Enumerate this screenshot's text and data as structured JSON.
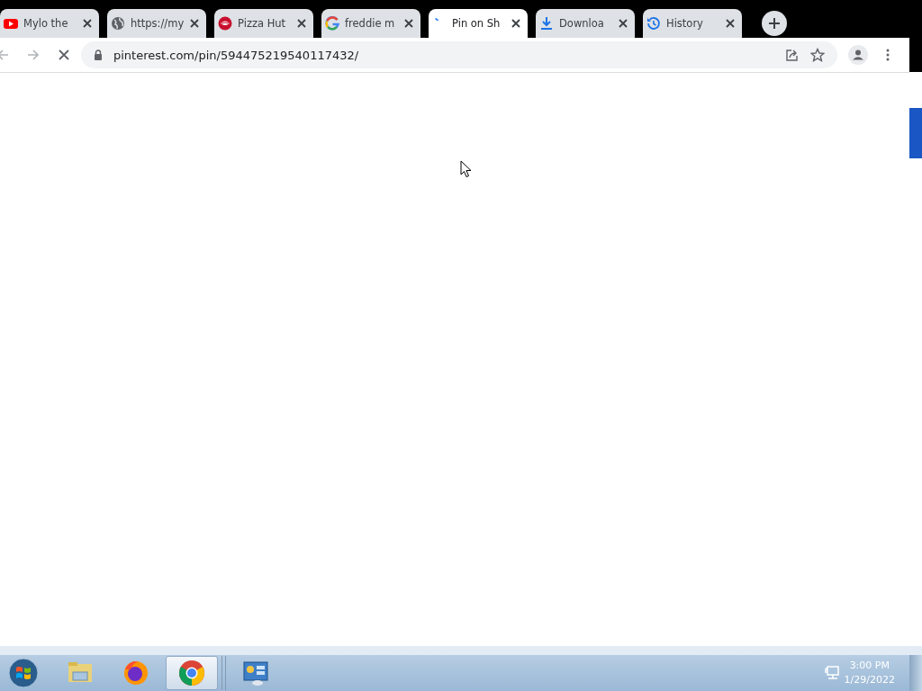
{
  "tabs": [
    {
      "title": "Mylo the",
      "kind": "video",
      "selected": false
    },
    {
      "title": "https://my",
      "kind": "globe",
      "selected": false
    },
    {
      "title": "Pizza Hut",
      "kind": "lips",
      "selected": false
    },
    {
      "title": "freddie m",
      "kind": "letter",
      "selected": false
    },
    {
      "title": "Pin on Sh",
      "kind": "loading",
      "selected": true
    },
    {
      "title": "Downloa",
      "kind": "download",
      "selected": false
    },
    {
      "title": "History",
      "kind": "history",
      "selected": false
    }
  ],
  "toolbar": {
    "url": "pinterest.com/pin/594475219540117432/",
    "loading": true
  },
  "taskbar": {
    "apps": [
      {
        "kind": "folder",
        "selected": false
      },
      {
        "kind": "fox",
        "selected": false
      },
      {
        "kind": "browser",
        "selected": true
      },
      {
        "kind": "panel",
        "selected": false
      }
    ],
    "time": "3:00 PM",
    "date": "1/29/2022"
  }
}
